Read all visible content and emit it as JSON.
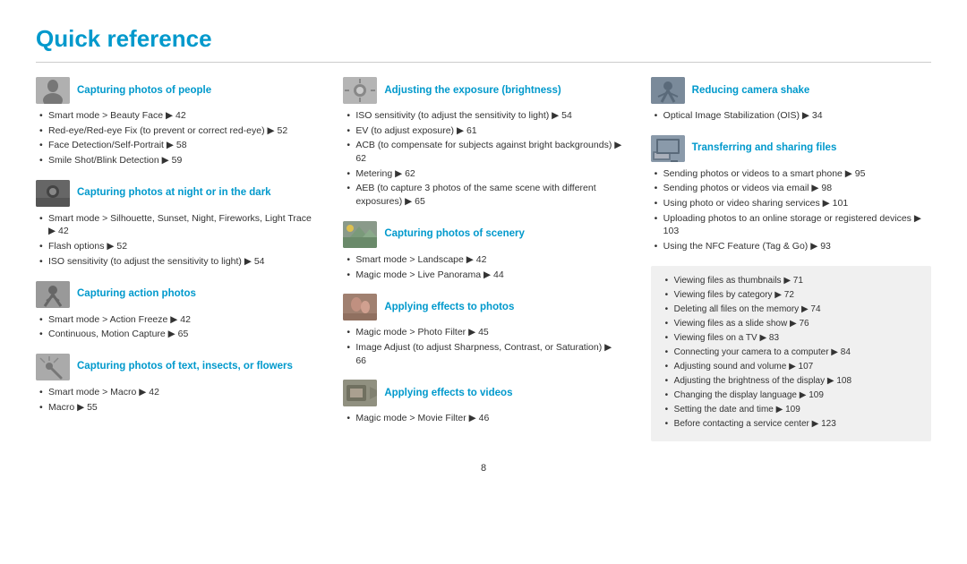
{
  "page": {
    "title": "Quick reference",
    "divider": true,
    "page_number": "8"
  },
  "columns": [
    {
      "sections": [
        {
          "id": "people",
          "icon": "people",
          "title": "Capturing photos of people",
          "items": [
            "Smart mode > Beauty Face ▶ 42",
            "Red-eye/Red-eye Fix (to prevent or correct red-eye) ▶ 52",
            "Face Detection/Self-Portrait ▶ 58",
            "Smile Shot/Blink Detection ▶ 59"
          ]
        },
        {
          "id": "night",
          "icon": "night",
          "title": "Capturing photos at night or in the dark",
          "items": [
            "Smart mode > Silhouette, Sunset, Night, Fireworks, Light Trace ▶ 42",
            "Flash options ▶ 52",
            "ISO sensitivity (to adjust the sensitivity to light) ▶ 54"
          ]
        },
        {
          "id": "action",
          "icon": "action",
          "title": "Capturing action photos",
          "items": [
            "Smart mode > Action Freeze ▶ 42",
            "Continuous, Motion Capture ▶ 65"
          ]
        },
        {
          "id": "text",
          "icon": "text",
          "title": "Capturing photos of text, insects, or flowers",
          "items": [
            "Smart mode > Macro ▶ 42",
            "Macro ▶ 55"
          ]
        }
      ]
    },
    {
      "sections": [
        {
          "id": "exposure",
          "icon": "exposure",
          "title": "Adjusting the exposure (brightness)",
          "items": [
            "ISO sensitivity (to adjust the sensitivity to light) ▶ 54",
            "EV (to adjust exposure) ▶ 61",
            "ACB (to compensate for subjects against bright backgrounds) ▶ 62",
            "Metering ▶ 62",
            "AEB (to capture 3 photos of the same scene with different exposures) ▶ 65"
          ]
        },
        {
          "id": "scenery",
          "icon": "scenery",
          "title": "Capturing photos of scenery",
          "items": [
            "Smart mode > Landscape ▶ 42",
            "Magic mode > Live Panorama ▶ 44"
          ]
        },
        {
          "id": "effects",
          "icon": "effects",
          "title": "Applying effects to photos",
          "items": [
            "Magic mode > Photo Filter ▶ 45",
            "Image Adjust (to adjust Sharpness, Contrast, or Saturation) ▶ 66"
          ]
        },
        {
          "id": "video-effects",
          "icon": "video-effects",
          "title": "Applying effects to videos",
          "items": [
            "Magic mode > Movie Filter ▶ 46"
          ]
        }
      ]
    },
    {
      "sections": [
        {
          "id": "camera-shake",
          "icon": "camera-shake",
          "title": "Reducing camera shake",
          "items": [
            "Optical Image Stabilization (OIS) ▶ 34"
          ]
        },
        {
          "id": "transfer",
          "icon": "transfer",
          "title": "Transferring and sharing files",
          "items": [
            "Sending photos or videos to a smart phone ▶ 95",
            "Sending photos or videos via email ▶ 98",
            "Using photo or video sharing services ▶ 101",
            "Uploading photos to an online storage or registered devices ▶ 103",
            "Using the NFC Feature (Tag & Go) ▶ 93"
          ]
        },
        {
          "id": "graybox",
          "graybox": true,
          "items": [
            "Viewing files as thumbnails ▶ 71",
            "Viewing files by category ▶ 72",
            "Deleting all files on the memory ▶ 74",
            "Viewing files as a slide show ▶ 76",
            "Viewing files on a TV ▶ 83",
            "Connecting your camera to a computer ▶ 84",
            "Adjusting sound and volume ▶ 107",
            "Adjusting the brightness of the display ▶ 108",
            "Changing the display language ▶ 109",
            "Setting the date and time ▶ 109",
            "Before contacting a service center ▶ 123"
          ]
        }
      ]
    }
  ]
}
